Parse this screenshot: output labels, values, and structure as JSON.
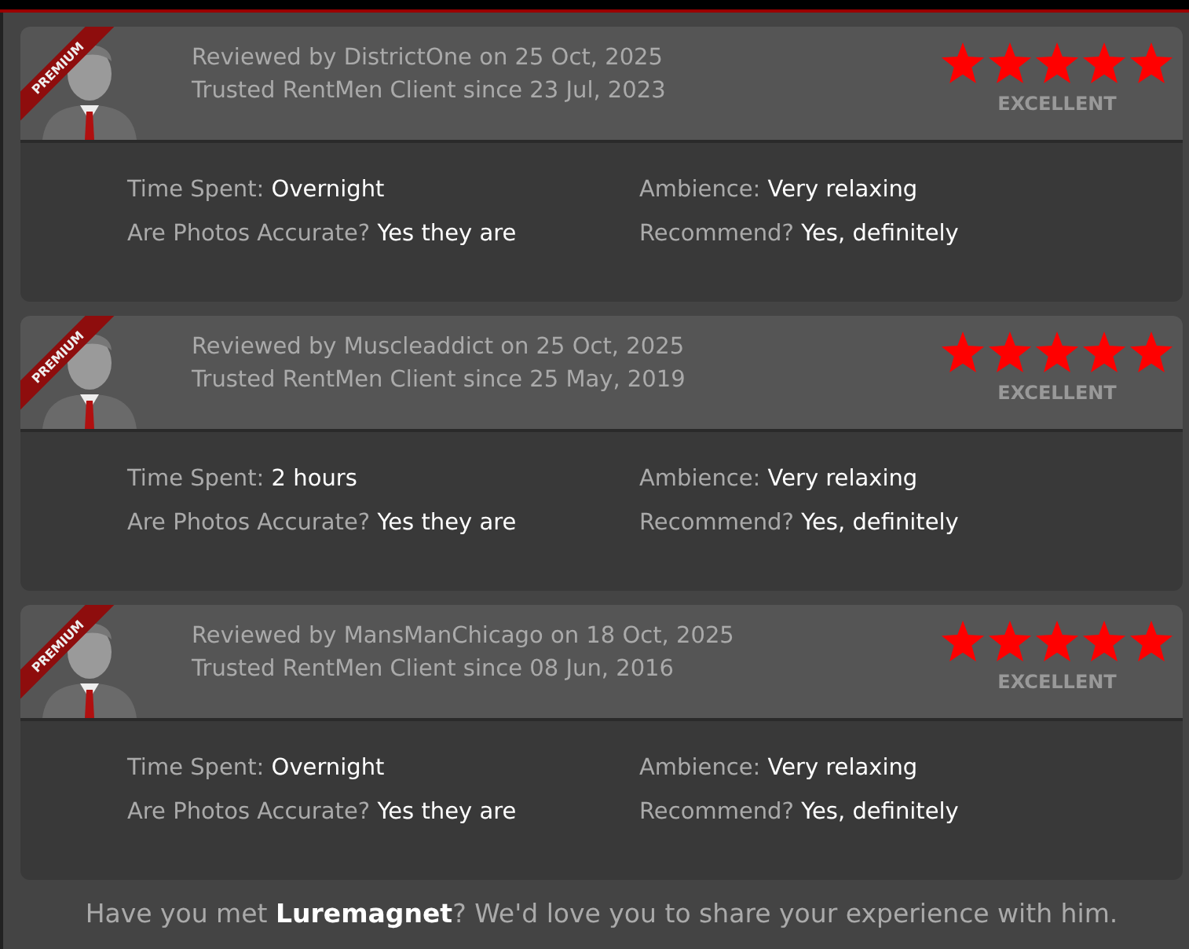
{
  "reviews": [
    {
      "badge": "PREMIUM",
      "reviewed_by": "Reviewed by DistrictOne on 25 Oct, 2025",
      "client_since": "Trusted RentMen Client since 23 Jul, 2023",
      "stars": 5,
      "rating_label": "EXCELLENT",
      "fields": [
        {
          "label": "Time Spent:",
          "value": "Overnight"
        },
        {
          "label": "Ambience:",
          "value": "Very relaxing"
        },
        {
          "label": "Are Photos Accurate?",
          "value": "Yes they are"
        },
        {
          "label": "Recommend?",
          "value": "Yes, definitely"
        }
      ]
    },
    {
      "badge": "PREMIUM",
      "reviewed_by": "Reviewed by Muscleaddict on 25 Oct, 2025",
      "client_since": "Trusted RentMen Client since 25 May, 2019",
      "stars": 5,
      "rating_label": "EXCELLENT",
      "fields": [
        {
          "label": "Time Spent:",
          "value": "2 hours"
        },
        {
          "label": "Ambience:",
          "value": "Very relaxing"
        },
        {
          "label": "Are Photos Accurate?",
          "value": "Yes they are"
        },
        {
          "label": "Recommend?",
          "value": "Yes, definitely"
        }
      ]
    },
    {
      "badge": "PREMIUM",
      "reviewed_by": "Reviewed by MansManChicago on 18 Oct, 2025",
      "client_since": "Trusted RentMen Client since 08 Jun, 2016",
      "stars": 5,
      "rating_label": "EXCELLENT",
      "fields": [
        {
          "label": "Time Spent:",
          "value": "Overnight"
        },
        {
          "label": "Ambience:",
          "value": "Very relaxing"
        },
        {
          "label": "Are Photos Accurate?",
          "value": "Yes they are"
        },
        {
          "label": "Recommend?",
          "value": "Yes, definitely"
        }
      ]
    }
  ],
  "footer": "Have you met **Luremagnet**? We'd love you to share your experience with him."
}
